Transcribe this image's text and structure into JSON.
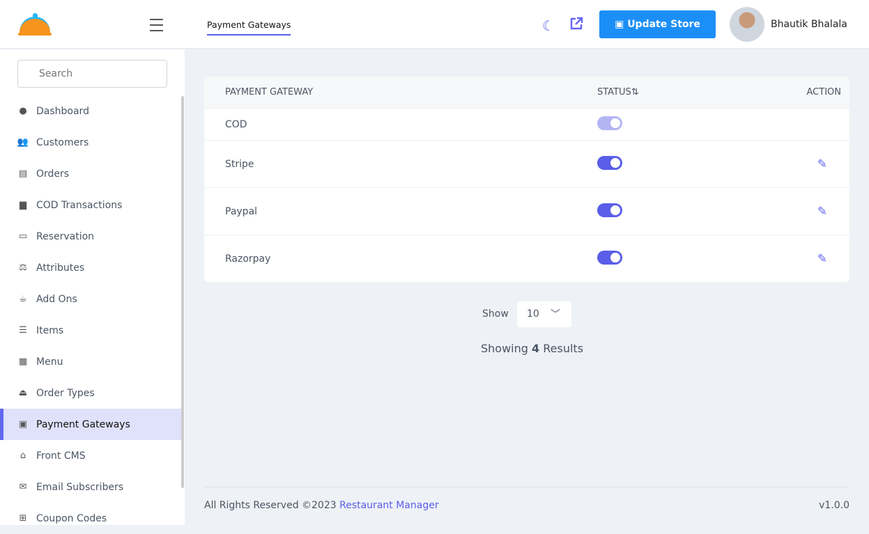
{
  "header": {
    "tab": "Payment Gateways",
    "update_store": "Update Store",
    "user_name": "Bhautik Bhalala"
  },
  "sidebar": {
    "search_placeholder": "Search",
    "items": [
      {
        "label": "Dashboard",
        "icon": "●"
      },
      {
        "label": "Customers",
        "icon": "👥"
      },
      {
        "label": "Orders",
        "icon": "▤"
      },
      {
        "label": "COD Transactions",
        "icon": "▆"
      },
      {
        "label": "Reservation",
        "icon": "▭"
      },
      {
        "label": "Attributes",
        "icon": "⚖"
      },
      {
        "label": "Add Ons",
        "icon": "☕"
      },
      {
        "label": "Items",
        "icon": "☰"
      },
      {
        "label": "Menu",
        "icon": "▦"
      },
      {
        "label": "Order Types",
        "icon": "⏏"
      },
      {
        "label": "Payment Gateways",
        "icon": "▣"
      },
      {
        "label": "Front CMS",
        "icon": "⌂"
      },
      {
        "label": "Email Subscribers",
        "icon": "✉"
      },
      {
        "label": "Coupon Codes",
        "icon": "⊞"
      }
    ]
  },
  "table": {
    "headers": [
      "PAYMENT GATEWAY",
      "STATUS⇅",
      "ACTION"
    ],
    "rows": [
      {
        "name": "COD",
        "enabled": true,
        "editable": false
      },
      {
        "name": "Stripe",
        "enabled": true,
        "editable": true
      },
      {
        "name": "Paypal",
        "enabled": true,
        "editable": true
      },
      {
        "name": "Razorpay",
        "enabled": true,
        "editable": true
      }
    ]
  },
  "pagination": {
    "show_label": "Show",
    "page_size": "10",
    "showing_prefix": "Showing",
    "count": "4",
    "showing_suffix": "Results"
  },
  "footer": {
    "text": "All Rights Reserved ©2023",
    "link": "Restaurant Manager",
    "version": "v1.0.0"
  }
}
